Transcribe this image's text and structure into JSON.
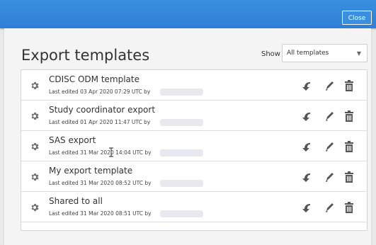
{
  "header": {
    "close_label": "Close",
    "accent": "#2f7fd6"
  },
  "page": {
    "title": "Export templates",
    "show_label": "Show",
    "filter_value": "All templates"
  },
  "templates": [
    {
      "name": "CDISC ODM template",
      "edited": "Last edited 03 Apr 2020 07:29 UTC by"
    },
    {
      "name": "Study coordinator export",
      "edited": "Last edited 01 Apr 2020 11:47 UTC by"
    },
    {
      "name": "SAS export",
      "edited": "Last edited 31 Mar 2020 14:04 UTC by"
    },
    {
      "name": "My export template",
      "edited": "Last edited 31 Mar 2020 08:52 UTC by"
    },
    {
      "name": "Shared to all",
      "edited": "Last edited 31 Mar 2020 08:51 UTC by"
    }
  ],
  "icons": {
    "settings": "gear-icon",
    "restore": "undo-icon",
    "edit": "pencil-icon",
    "delete": "trash-icon",
    "dropdown": "chevron-down-icon"
  }
}
